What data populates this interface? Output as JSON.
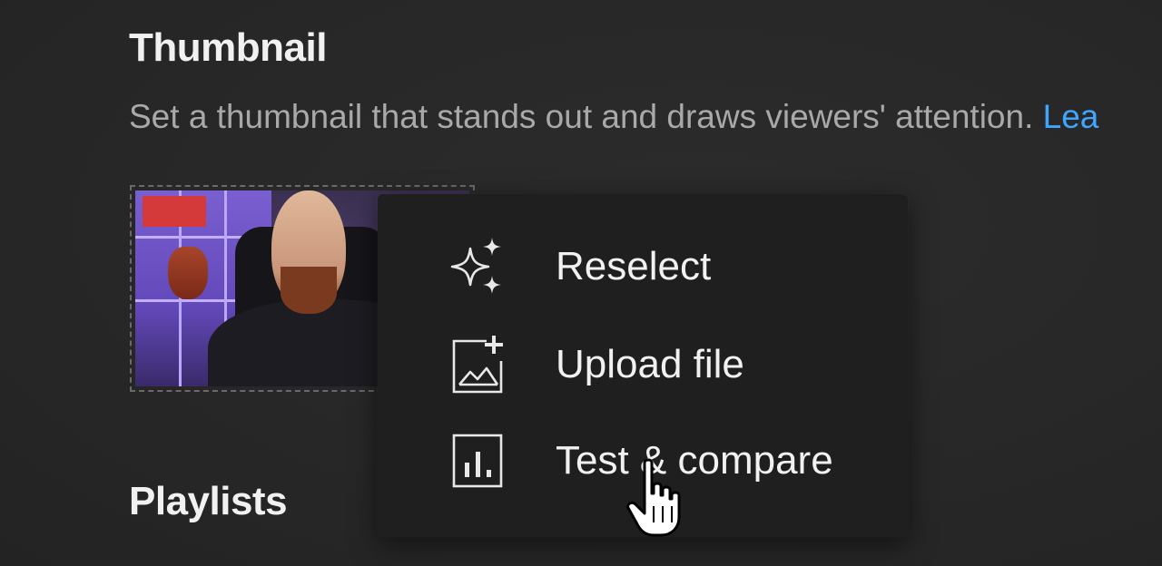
{
  "thumbnail_section": {
    "title": "Thumbnail",
    "description": "Set a thumbnail that stands out and draws viewers' attention.",
    "learn_more": "Lea"
  },
  "playlists_section": {
    "title": "Playlists"
  },
  "thumbnail_menu": {
    "items": [
      {
        "label": "Reselect",
        "icon": "sparkle-icon"
      },
      {
        "label": "Upload file",
        "icon": "image-add-icon"
      },
      {
        "label": "Test & compare",
        "icon": "bar-chart-icon"
      }
    ]
  },
  "colors": {
    "background": "#282828",
    "menu_background": "#1f1f1f",
    "text": "#f1f1f1",
    "secondary_text": "#a9a9a9",
    "link": "#3ea6ff"
  }
}
